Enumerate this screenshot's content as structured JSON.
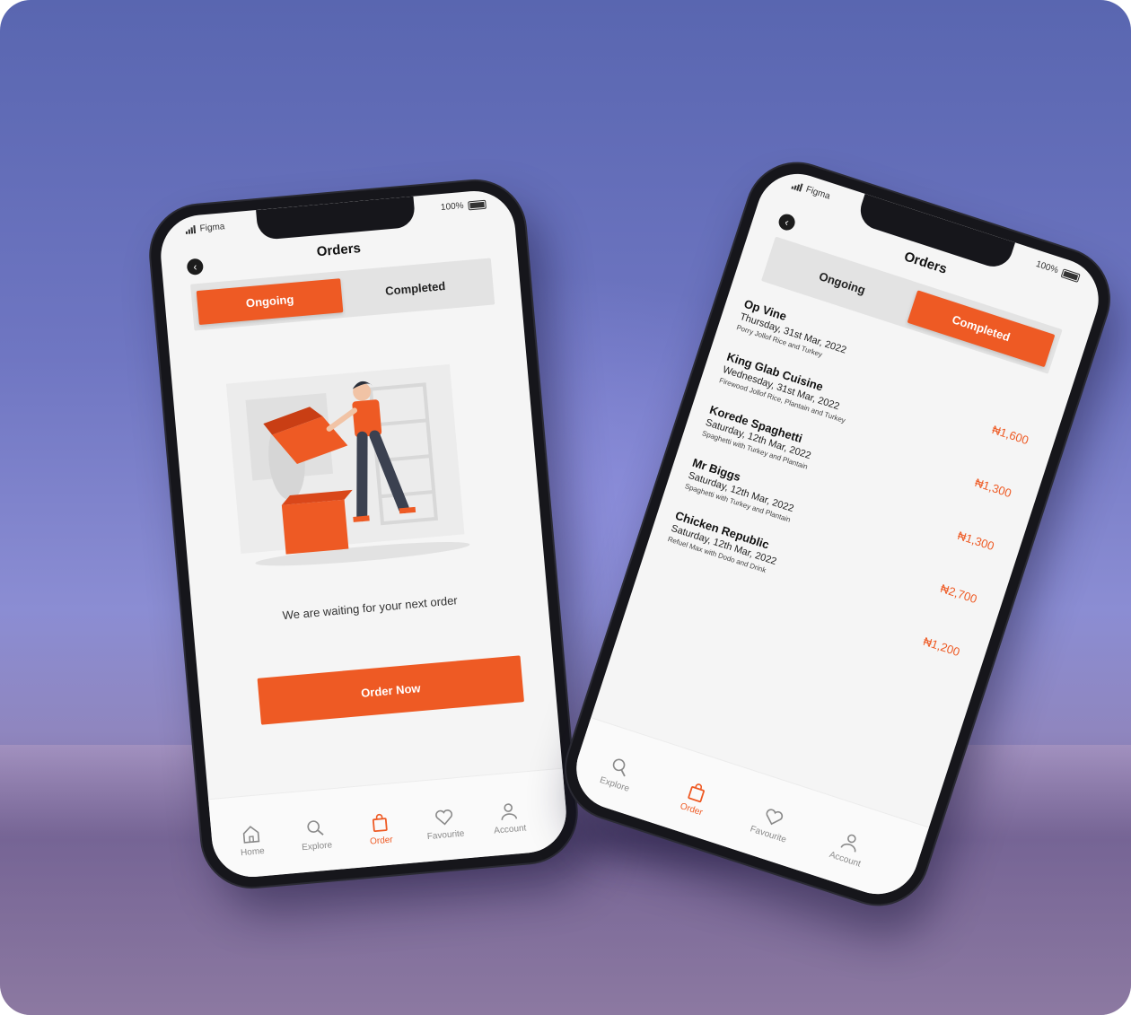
{
  "colors": {
    "accent": "#ee5a24",
    "background": "#6f76c2"
  },
  "status": {
    "carrier": "Figma",
    "battery": "100%"
  },
  "phone_ongoing": {
    "title": "Orders",
    "tabs": {
      "ongoing": "Ongoing",
      "completed": "Completed"
    },
    "empty_message": "We are waiting for your next order",
    "order_button": "Order Now",
    "nav": [
      {
        "label": "Home",
        "icon": "home-icon"
      },
      {
        "label": "Explore",
        "icon": "search-icon"
      },
      {
        "label": "Order",
        "icon": "shopping-bag-icon",
        "active": true
      },
      {
        "label": "Favourite",
        "icon": "heart-icon"
      },
      {
        "label": "Account",
        "icon": "user-icon"
      }
    ]
  },
  "phone_completed": {
    "title": "Orders",
    "tabs": {
      "ongoing": "Ongoing",
      "completed": "Completed"
    },
    "orders": [
      {
        "name": "Op Vine",
        "date": "Thursday, 31st Mar, 2022",
        "items": "Porry Jollof Rice and Turkey",
        "price": "₦1,600"
      },
      {
        "name": "King Glab Cuisine",
        "date": "Wednesday, 31st Mar, 2022",
        "items": "Firewood Jollof Rice, Plantain and Turkey",
        "price": "₦1,300"
      },
      {
        "name": "Korede Spaghetti",
        "date": "Saturday, 12th Mar, 2022",
        "items": "Spaghetti with Turkey and Plantain",
        "price": "₦1,300"
      },
      {
        "name": "Mr Biggs",
        "date": "Saturday, 12th Mar, 2022",
        "items": "Spaghetti with Turkey and Plantain",
        "price": "₦2,700"
      },
      {
        "name": "Chicken Republic",
        "date": "Saturday, 12th Mar, 2022",
        "items": "Refuel Max with Dodo and Drink",
        "price": "₦1,200"
      }
    ],
    "nav": [
      {
        "label": "Explore",
        "icon": "search-icon"
      },
      {
        "label": "Order",
        "icon": "shopping-bag-icon",
        "active": true
      },
      {
        "label": "Favourite",
        "icon": "heart-icon"
      },
      {
        "label": "Account",
        "icon": "user-icon"
      }
    ]
  }
}
